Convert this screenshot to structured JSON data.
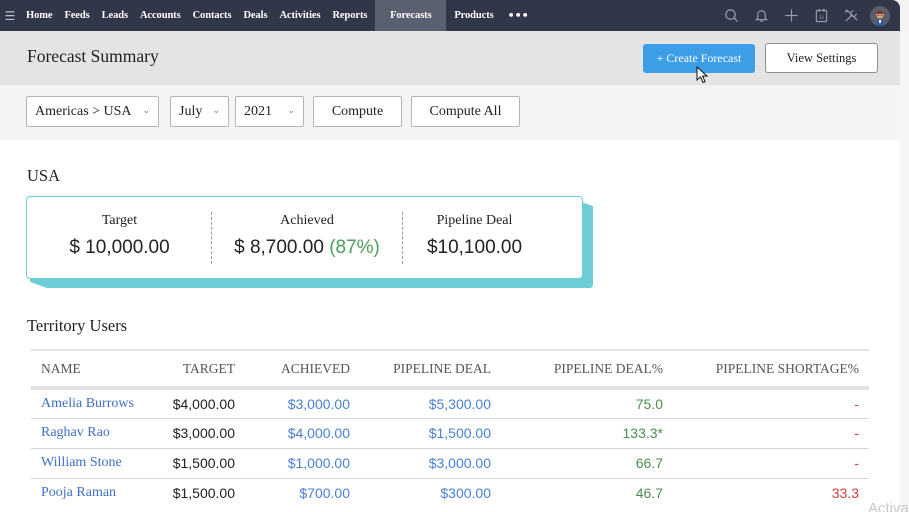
{
  "nav": {
    "menu_icon": "hamburger-icon",
    "items": [
      {
        "label": "Home",
        "active": false
      },
      {
        "label": "Feeds",
        "active": false
      },
      {
        "label": "Leads",
        "active": false
      },
      {
        "label": "Accounts",
        "active": false
      },
      {
        "label": "Contacts",
        "active": false
      },
      {
        "label": "Deals",
        "active": false
      },
      {
        "label": "Activities",
        "active": false
      },
      {
        "label": "Reports",
        "active": false
      },
      {
        "label": "Forecasts",
        "active": true
      },
      {
        "label": "Products",
        "active": false
      }
    ],
    "more_label": "•••",
    "right_icons": [
      "search-icon",
      "bell-icon",
      "plus-icon",
      "calendar-icon",
      "tools-icon",
      "avatar"
    ],
    "calendar_day": "31"
  },
  "header": {
    "title": "Forecast Summary",
    "create_button": "+ Create Forecast",
    "view_settings_button": "View Settings",
    "accent_color": "#3d9ee8"
  },
  "filters": {
    "territory": "Americas > USA",
    "month": "July",
    "year": "2021",
    "compute_label": "Compute",
    "compute_all_label": "Compute All"
  },
  "summary": {
    "region": "USA",
    "target_label": "Target",
    "target_value": "$ 10,000.00",
    "achieved_label": "Achieved",
    "achieved_value": "$ 8,700.00",
    "achieved_pct": "(87%)",
    "pipeline_label": "Pipeline Deal",
    "pipeline_value": "$10,100.00",
    "card_accent": "#6ecdd6"
  },
  "territory_users": {
    "title": "Territory Users",
    "columns": [
      "NAME",
      "TARGET",
      "ACHIEVED",
      "PIPELINE DEAL",
      "PIPELINE DEAL%",
      "PIPELINE SHORTAGE%"
    ],
    "rows": [
      {
        "name": "Amelia Burrows",
        "target": "$4,000.00",
        "achieved": "$3,000.00",
        "pipeline": "$5,300.00",
        "pipeline_pct": "75.0",
        "shortage_pct": "-"
      },
      {
        "name": "Raghav Rao",
        "target": "$3,000.00",
        "achieved": "$4,000.00",
        "pipeline": "$1,500.00",
        "pipeline_pct": "133.3*",
        "shortage_pct": "-"
      },
      {
        "name": "William Stone",
        "target": "$1,500.00",
        "achieved": "$1,000.00",
        "pipeline": "$3,000.00",
        "pipeline_pct": "66.7",
        "shortage_pct": "-"
      },
      {
        "name": "Pooja Raman",
        "target": "$1,500.00",
        "achieved": "$700.00",
        "pipeline": "$300.00",
        "pipeline_pct": "46.7",
        "shortage_pct": "33.3"
      }
    ]
  },
  "overlay": {
    "watermark": "Activate"
  }
}
